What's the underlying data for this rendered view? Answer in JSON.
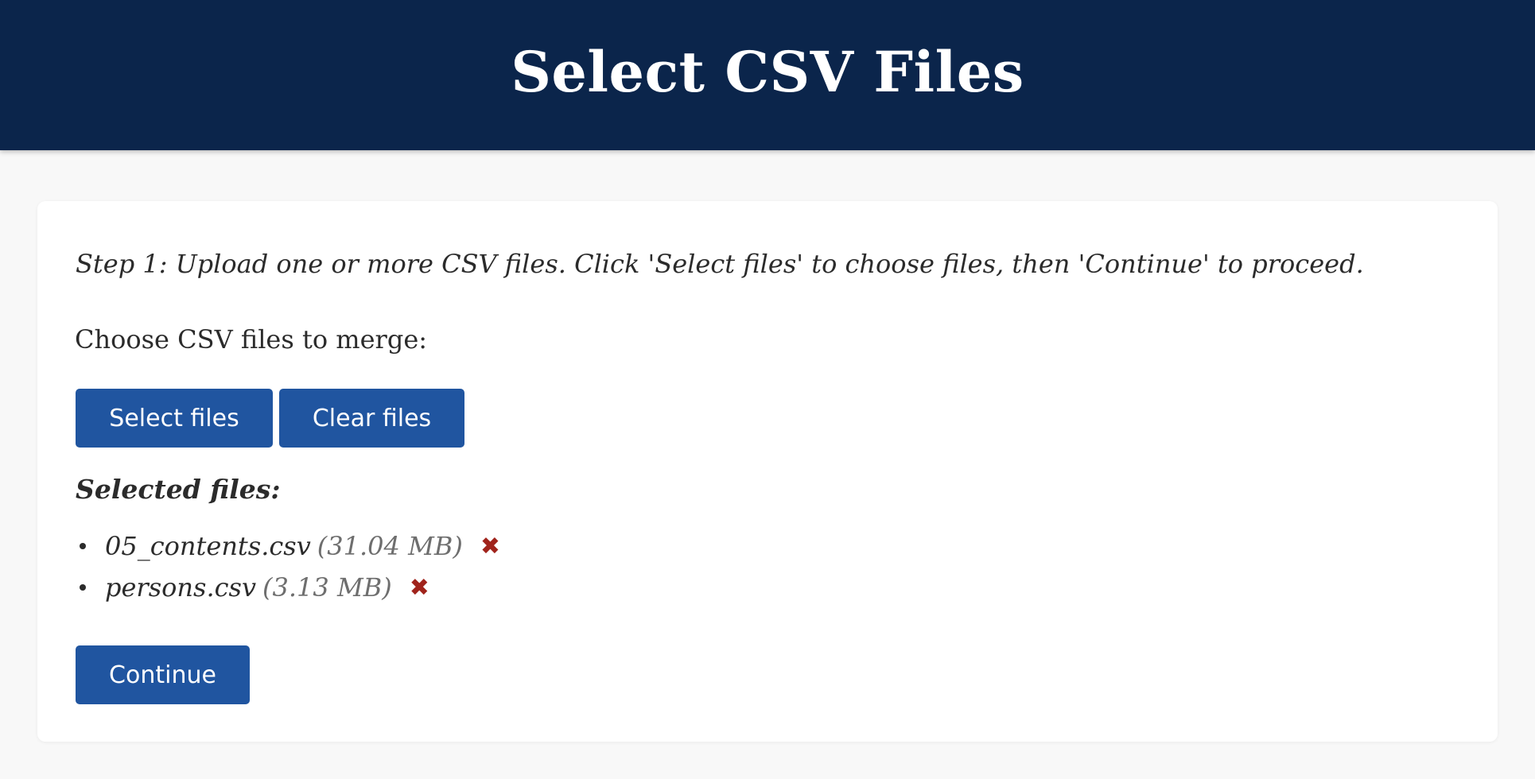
{
  "header": {
    "title": "Select CSV Files",
    "background_color": "#0b254b"
  },
  "card": {
    "instructions": "Step 1: Upload one or more CSV files. Click 'Select files' to choose files, then 'Continue' to proceed.",
    "choose_label": "Choose CSV files to merge:",
    "buttons": {
      "select_files": "Select files",
      "clear_files": "Clear files",
      "continue": "Continue"
    },
    "button_color": "#2055a0",
    "selected_heading": "Selected files:",
    "files": [
      {
        "name": "05_contents.csv",
        "size": "(31.04 MB)",
        "remove_icon": "close-x-icon"
      },
      {
        "name": "persons.csv",
        "size": "(3.13 MB)",
        "remove_icon": "close-x-icon"
      }
    ],
    "remove_icon_glyph": "✖",
    "remove_icon_color": "#a0231b"
  }
}
